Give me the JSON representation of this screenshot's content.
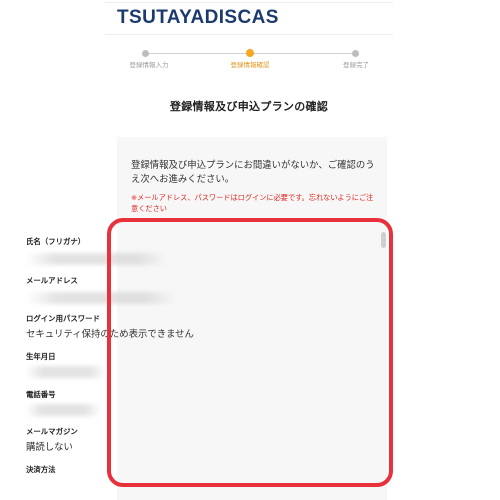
{
  "brand": {
    "logo_part1": "TSUTAYA",
    "logo_part2": "DISCAS"
  },
  "stepper": {
    "steps": [
      {
        "label": "登録情報入力",
        "state": "done"
      },
      {
        "label": "登録情報確認",
        "state": "active"
      },
      {
        "label": "登録完了",
        "state": "pending"
      }
    ],
    "active_color": "#f5a623"
  },
  "page_title": "登録情報及び申込プランの確認",
  "intro_text": "登録情報及び申込プランにお間違いがないか、ご確認のうえ次へお進みください。",
  "warning_text": "※メールアドレス、パスワードはログインに必要です。忘れないようにご注意ください",
  "fields": [
    {
      "label": "氏名（フリガナ）",
      "value": "",
      "redacted": true
    },
    {
      "label": "メールアドレス",
      "value": "",
      "redacted": true
    },
    {
      "label": "ログイン用パスワード",
      "value": "セキュリティ保持のため表示できません",
      "redacted": false
    },
    {
      "label": "生年月日",
      "value": "",
      "redacted": true
    },
    {
      "label": "電話番号",
      "value": "",
      "redacted": true
    },
    {
      "label": "メールマガジン",
      "value": "購読しない",
      "redacted": false
    },
    {
      "label": "決済方法",
      "value": "",
      "redacted": false
    }
  ],
  "colors": {
    "warning": "#e0261e",
    "highlight": "#e8313a",
    "logo": "#1d3a6e"
  }
}
